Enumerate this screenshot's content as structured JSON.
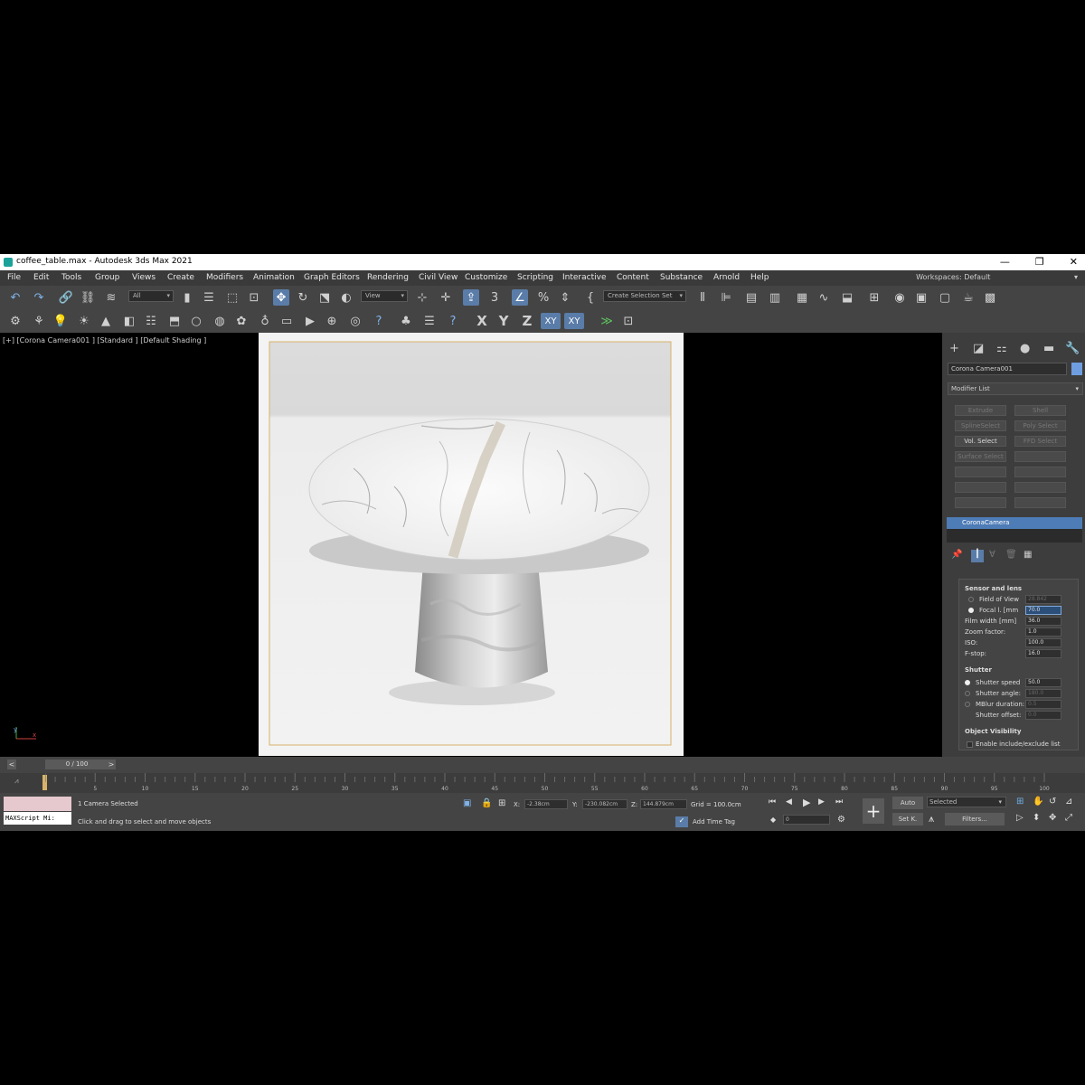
{
  "window": {
    "title": "coffee_table.max - Autodesk 3ds Max 2021",
    "minimize": "—",
    "restore": "❐",
    "close": "✕"
  },
  "menu": [
    "File",
    "Edit",
    "Tools",
    "Group",
    "Views",
    "Create",
    "Modifiers",
    "Animation",
    "Graph Editors",
    "Rendering",
    "Civil View",
    "Customize",
    "Scripting",
    "Interactive",
    "Content",
    "Substance",
    "Arnold",
    "Help"
  ],
  "workspaces": {
    "label": "Workspaces:",
    "value": "Default"
  },
  "toolbar": {
    "selection_filter": "All",
    "ref_coord": "View",
    "snap_angle": "3",
    "create_selection_set": "Create Selection Set",
    "axis_x": "X",
    "axis_y": "Y",
    "axis_z": "Z",
    "axis_xy": "XY",
    "axis_xy2": "XY"
  },
  "viewport": {
    "label": "[+] [Corona Camera001 ] [Standard ] [Default Shading ]",
    "axis_y": "y",
    "axis_x": "x"
  },
  "command_panel": {
    "object_name": "Corona Camera001",
    "modifier_list": "Modifier List",
    "modifier_buttons": [
      "Extrude",
      "Shell",
      "SplineSelect",
      "Poly Select",
      "Vol. Select",
      "FFD Select",
      "Surface Select"
    ],
    "stack_item": "CoronaCamera",
    "rollout": {
      "section_sensor": "Sensor and lens",
      "fov_label": "Field of View",
      "fov_value": "28.842",
      "focal_label": "Focal l. [mm",
      "focal_value": "70.0",
      "film_label": "Film width [mm]",
      "film_value": "36.0",
      "zoom_label": "Zoom factor:",
      "zoom_value": "1.0",
      "iso_label": "ISO:",
      "iso_value": "100.0",
      "fstop_label": "F-stop:",
      "fstop_value": "16.0",
      "section_shutter": "Shutter",
      "speed_label": "Shutter speed",
      "speed_value": "50.0",
      "angle_label": "Shutter angle:",
      "angle_value": "180.0",
      "mblur_label": "MBlur duration:",
      "mblur_value": "0.5",
      "offset_label": "Shutter offset:",
      "offset_value": "0.0",
      "section_visibility": "Object Visibility",
      "include_label": "Enable include/exclude list"
    }
  },
  "time": {
    "slider": "0 / 100",
    "ticks": [
      "0",
      "5",
      "10",
      "15",
      "20",
      "25",
      "30",
      "35",
      "40",
      "45",
      "50",
      "55",
      "60",
      "65",
      "70",
      "75",
      "80",
      "85",
      "90",
      "95",
      "100"
    ]
  },
  "status": {
    "maxscript": "MAXScript Mi:",
    "selected": "1 Camera Selected",
    "prompt": "Click and drag to select and move objects",
    "x_label": "X:",
    "x_value": "-2.38cm",
    "y_label": "Y:",
    "y_value": "-230.082cm",
    "z_label": "Z:",
    "z_value": "144.879cm",
    "grid": "Grid = 100.0cm",
    "add_time_tag": "Add Time Tag",
    "frame": "0",
    "auto": "Auto",
    "set_key": "Set K.",
    "key_filter": "Selected",
    "filters": "Filters..."
  }
}
